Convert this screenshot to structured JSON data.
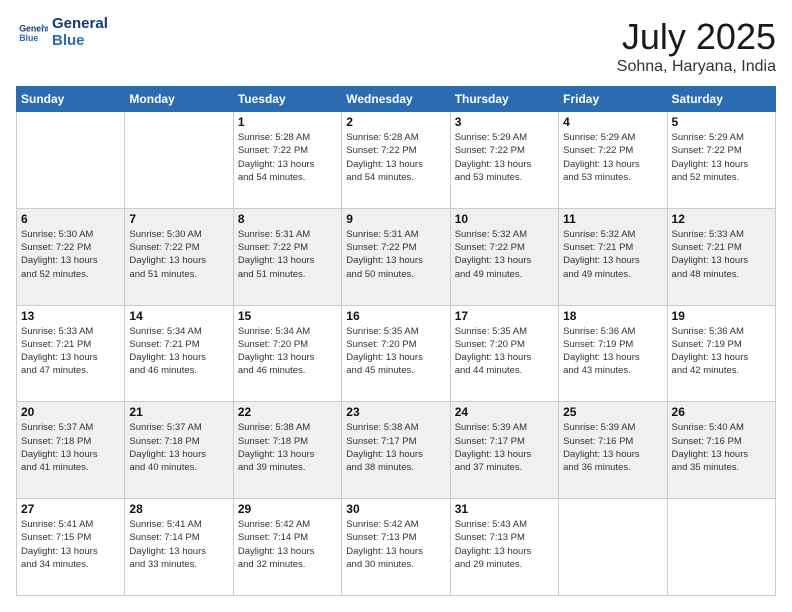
{
  "header": {
    "logo_line1": "General",
    "logo_line2": "Blue",
    "month": "July 2025",
    "location": "Sohna, Haryana, India"
  },
  "weekdays": [
    "Sunday",
    "Monday",
    "Tuesday",
    "Wednesday",
    "Thursday",
    "Friday",
    "Saturday"
  ],
  "weeks": [
    [
      {
        "day": "",
        "info": ""
      },
      {
        "day": "",
        "info": ""
      },
      {
        "day": "1",
        "info": "Sunrise: 5:28 AM\nSunset: 7:22 PM\nDaylight: 13 hours\nand 54 minutes."
      },
      {
        "day": "2",
        "info": "Sunrise: 5:28 AM\nSunset: 7:22 PM\nDaylight: 13 hours\nand 54 minutes."
      },
      {
        "day": "3",
        "info": "Sunrise: 5:29 AM\nSunset: 7:22 PM\nDaylight: 13 hours\nand 53 minutes."
      },
      {
        "day": "4",
        "info": "Sunrise: 5:29 AM\nSunset: 7:22 PM\nDaylight: 13 hours\nand 53 minutes."
      },
      {
        "day": "5",
        "info": "Sunrise: 5:29 AM\nSunset: 7:22 PM\nDaylight: 13 hours\nand 52 minutes."
      }
    ],
    [
      {
        "day": "6",
        "info": "Sunrise: 5:30 AM\nSunset: 7:22 PM\nDaylight: 13 hours\nand 52 minutes."
      },
      {
        "day": "7",
        "info": "Sunrise: 5:30 AM\nSunset: 7:22 PM\nDaylight: 13 hours\nand 51 minutes."
      },
      {
        "day": "8",
        "info": "Sunrise: 5:31 AM\nSunset: 7:22 PM\nDaylight: 13 hours\nand 51 minutes."
      },
      {
        "day": "9",
        "info": "Sunrise: 5:31 AM\nSunset: 7:22 PM\nDaylight: 13 hours\nand 50 minutes."
      },
      {
        "day": "10",
        "info": "Sunrise: 5:32 AM\nSunset: 7:22 PM\nDaylight: 13 hours\nand 49 minutes."
      },
      {
        "day": "11",
        "info": "Sunrise: 5:32 AM\nSunset: 7:21 PM\nDaylight: 13 hours\nand 49 minutes."
      },
      {
        "day": "12",
        "info": "Sunrise: 5:33 AM\nSunset: 7:21 PM\nDaylight: 13 hours\nand 48 minutes."
      }
    ],
    [
      {
        "day": "13",
        "info": "Sunrise: 5:33 AM\nSunset: 7:21 PM\nDaylight: 13 hours\nand 47 minutes."
      },
      {
        "day": "14",
        "info": "Sunrise: 5:34 AM\nSunset: 7:21 PM\nDaylight: 13 hours\nand 46 minutes."
      },
      {
        "day": "15",
        "info": "Sunrise: 5:34 AM\nSunset: 7:20 PM\nDaylight: 13 hours\nand 46 minutes."
      },
      {
        "day": "16",
        "info": "Sunrise: 5:35 AM\nSunset: 7:20 PM\nDaylight: 13 hours\nand 45 minutes."
      },
      {
        "day": "17",
        "info": "Sunrise: 5:35 AM\nSunset: 7:20 PM\nDaylight: 13 hours\nand 44 minutes."
      },
      {
        "day": "18",
        "info": "Sunrise: 5:36 AM\nSunset: 7:19 PM\nDaylight: 13 hours\nand 43 minutes."
      },
      {
        "day": "19",
        "info": "Sunrise: 5:36 AM\nSunset: 7:19 PM\nDaylight: 13 hours\nand 42 minutes."
      }
    ],
    [
      {
        "day": "20",
        "info": "Sunrise: 5:37 AM\nSunset: 7:18 PM\nDaylight: 13 hours\nand 41 minutes."
      },
      {
        "day": "21",
        "info": "Sunrise: 5:37 AM\nSunset: 7:18 PM\nDaylight: 13 hours\nand 40 minutes."
      },
      {
        "day": "22",
        "info": "Sunrise: 5:38 AM\nSunset: 7:18 PM\nDaylight: 13 hours\nand 39 minutes."
      },
      {
        "day": "23",
        "info": "Sunrise: 5:38 AM\nSunset: 7:17 PM\nDaylight: 13 hours\nand 38 minutes."
      },
      {
        "day": "24",
        "info": "Sunrise: 5:39 AM\nSunset: 7:17 PM\nDaylight: 13 hours\nand 37 minutes."
      },
      {
        "day": "25",
        "info": "Sunrise: 5:39 AM\nSunset: 7:16 PM\nDaylight: 13 hours\nand 36 minutes."
      },
      {
        "day": "26",
        "info": "Sunrise: 5:40 AM\nSunset: 7:16 PM\nDaylight: 13 hours\nand 35 minutes."
      }
    ],
    [
      {
        "day": "27",
        "info": "Sunrise: 5:41 AM\nSunset: 7:15 PM\nDaylight: 13 hours\nand 34 minutes."
      },
      {
        "day": "28",
        "info": "Sunrise: 5:41 AM\nSunset: 7:14 PM\nDaylight: 13 hours\nand 33 minutes."
      },
      {
        "day": "29",
        "info": "Sunrise: 5:42 AM\nSunset: 7:14 PM\nDaylight: 13 hours\nand 32 minutes."
      },
      {
        "day": "30",
        "info": "Sunrise: 5:42 AM\nSunset: 7:13 PM\nDaylight: 13 hours\nand 30 minutes."
      },
      {
        "day": "31",
        "info": "Sunrise: 5:43 AM\nSunset: 7:13 PM\nDaylight: 13 hours\nand 29 minutes."
      },
      {
        "day": "",
        "info": ""
      },
      {
        "day": "",
        "info": ""
      }
    ]
  ]
}
